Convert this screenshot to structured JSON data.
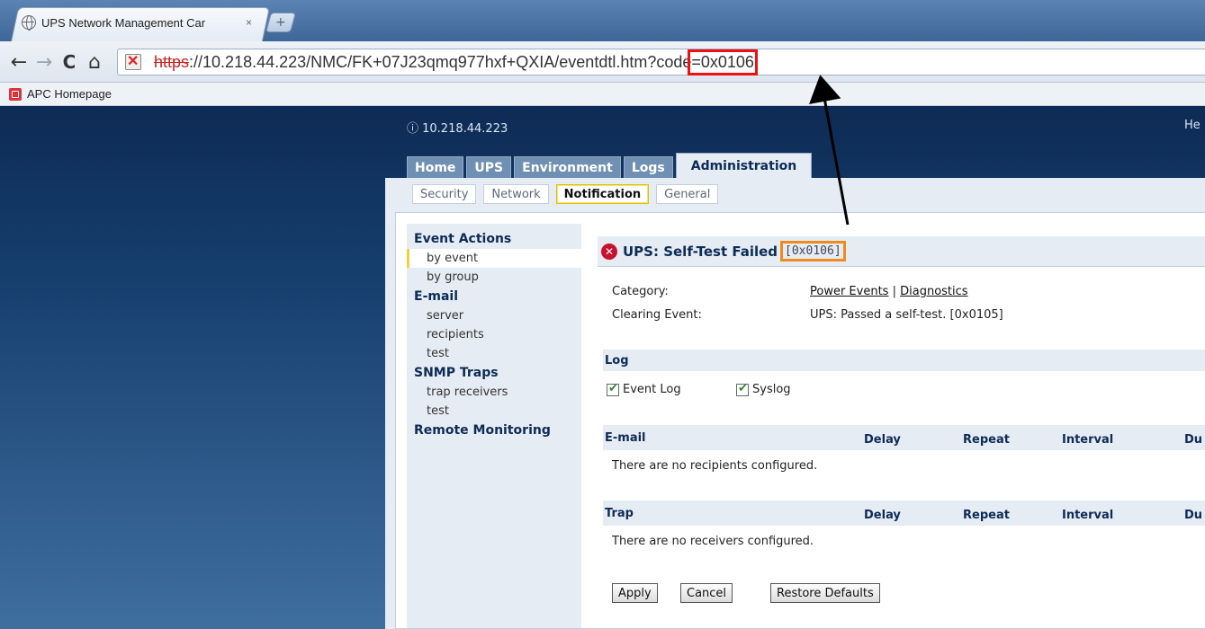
{
  "browser": {
    "tab_title": "UPS Network Management Car",
    "tab_close": "×",
    "new_tab": "+",
    "url_scheme": "https",
    "url_middle": "://10.218.44.223/NMC/FK+07J23qmq977hxf+QXIA/eventdtl.htm?code",
    "url_code": "=0x0106",
    "bookmark": "APC Homepage"
  },
  "header": {
    "ip": "ⓘ 10.218.44.223",
    "help": "He"
  },
  "main_tabs": [
    "Home",
    "UPS",
    "Environment",
    "Logs",
    "Administration"
  ],
  "sub_tabs": [
    "Security",
    "Network",
    "Notification",
    "General"
  ],
  "sidebar": {
    "event_actions": "Event Actions",
    "by_event": "by event",
    "by_group": "by group",
    "email": "E-mail",
    "server": "server",
    "recipients": "recipients",
    "email_test": "test",
    "snmp": "SNMP Traps",
    "trap_receivers": "trap receivers",
    "snmp_test": "test",
    "remote": "Remote Monitoring"
  },
  "event": {
    "title": "UPS: Self-Test Failed",
    "code": "[0x0106]",
    "category_label": "Category:",
    "category_power": "Power Events",
    "category_sep": " | ",
    "category_diag": "Diagnostics",
    "clearing_label": "Clearing Event:",
    "clearing_value": "UPS: Passed a self-test. [0x0105]"
  },
  "log": {
    "title": "Log",
    "event_log": "Event Log",
    "syslog": "Syslog"
  },
  "email_section": {
    "title": "E-mail",
    "delay": "Delay",
    "repeat": "Repeat",
    "interval": "Interval",
    "du": "Du",
    "empty": "There are no recipients configured."
  },
  "trap_section": {
    "title": "Trap",
    "delay": "Delay",
    "repeat": "Repeat",
    "interval": "Interval",
    "du": "Du",
    "empty": "There are no receivers configured."
  },
  "buttons": {
    "apply": "Apply",
    "cancel": "Cancel",
    "restore": "Restore Defaults"
  }
}
